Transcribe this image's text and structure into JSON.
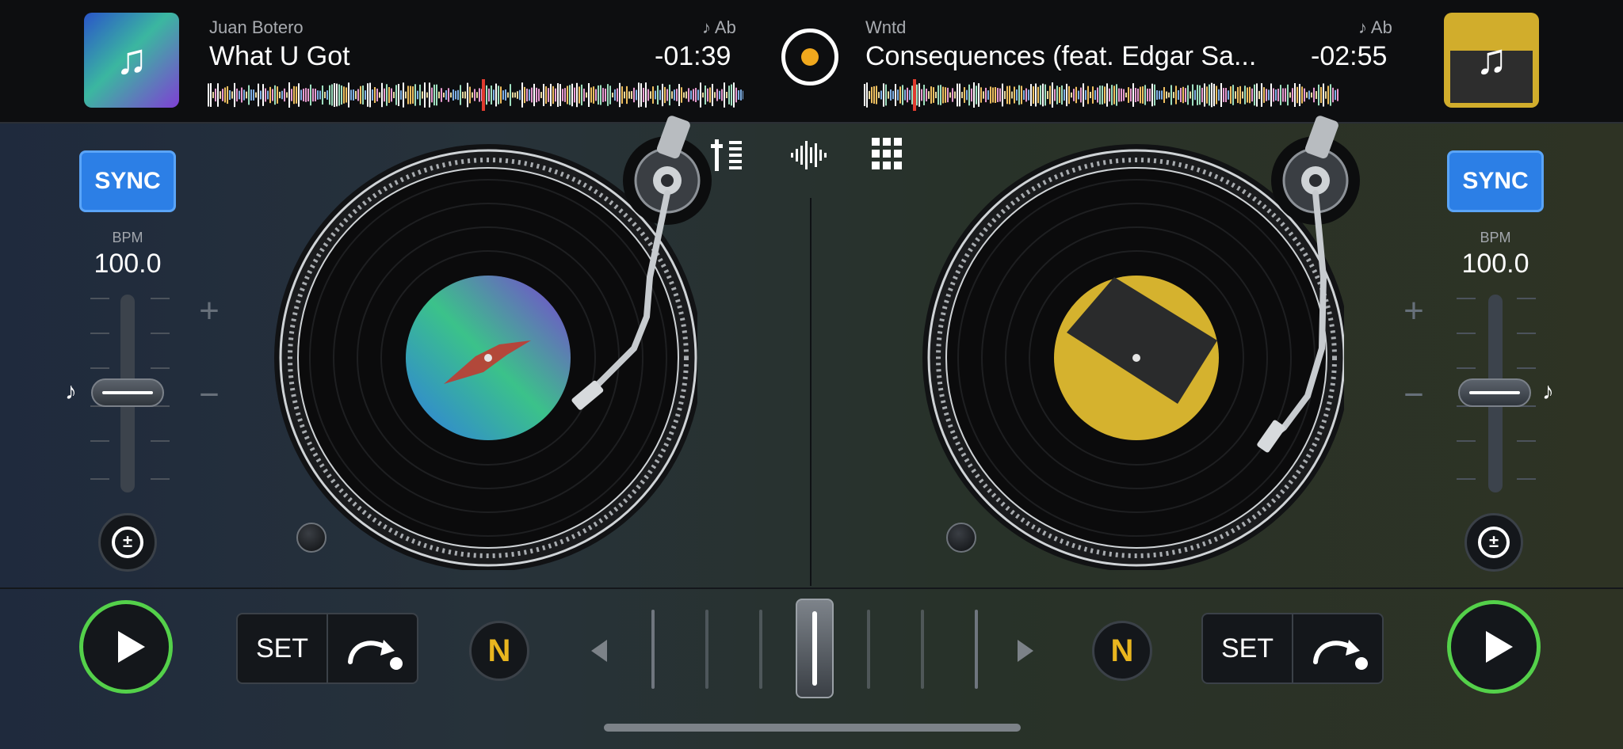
{
  "deck_a": {
    "artist": "Juan Botero",
    "title": "What U Got",
    "key": "♪ Ab",
    "time": "-01:39",
    "sync": "SYNC",
    "bpm_label": "BPM",
    "bpm": "100.0",
    "plus": "+",
    "minus": "−",
    "set": "SET",
    "n_label": "N"
  },
  "deck_b": {
    "artist": "Wntd",
    "title": "Consequences (feat. Edgar Sa...",
    "key": "♪ Ab",
    "time": "-02:55",
    "sync": "SYNC",
    "bpm_label": "BPM",
    "bpm": "100.0",
    "plus": "+",
    "minus": "−",
    "set": "SET",
    "n_label": "N"
  },
  "icons": {
    "note": "♪",
    "cover_note": "♫"
  },
  "colors": {
    "sync_blue": "#2c7fe6",
    "play_green": "#54d14a",
    "record_orange": "#f0a81d",
    "playhead_red": "#e03b2f"
  }
}
